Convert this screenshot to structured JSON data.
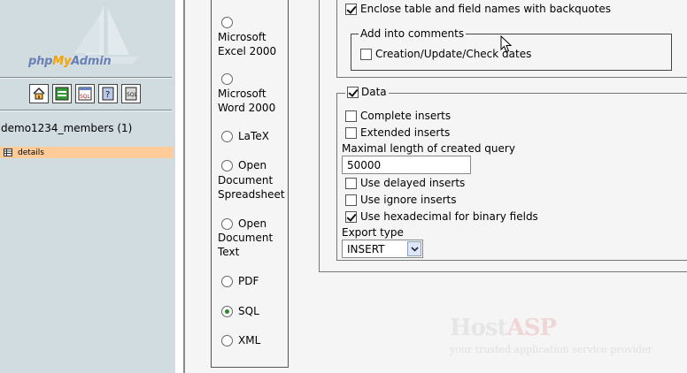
{
  "nav": {
    "logo": {
      "part1": "php",
      "part2": "My",
      "part3": "Admin"
    },
    "toolbar": [
      {
        "icon": "home-icon"
      },
      {
        "icon": "query-window-icon"
      },
      {
        "icon": "sql-icon"
      },
      {
        "icon": "help-icon"
      },
      {
        "icon": "documentation-icon"
      }
    ],
    "database": "demo1234_members (1)",
    "tables": [
      {
        "name": "details"
      }
    ]
  },
  "export": {
    "formats": [
      {
        "label1": "Microsoft",
        "label2": "Excel 2000",
        "selected": false
      },
      {
        "label1": "Microsoft",
        "label2": "Word 2000",
        "selected": false
      },
      {
        "label1": "LaTeX",
        "selected": false
      },
      {
        "label1": "Open",
        "label2": "Document",
        "label3": "Spreadsheet",
        "selected": false
      },
      {
        "label1": "Open",
        "label2": "Document",
        "label3": "Text",
        "selected": false
      },
      {
        "label1": "PDF",
        "selected": false
      },
      {
        "label1": "SQL",
        "selected": true
      },
      {
        "label1": "XML",
        "selected": false
      }
    ],
    "structure": {
      "backquotes": {
        "label": "Enclose table and field names with backquotes",
        "checked": true
      },
      "comments_legend": "Add into comments",
      "creation_dates": {
        "label": "Creation/Update/Check dates",
        "checked": false
      }
    },
    "data": {
      "legend": "Data",
      "checked": true,
      "complete_inserts": {
        "label": "Complete inserts",
        "checked": false
      },
      "extended_inserts": {
        "label": "Extended inserts",
        "checked": false
      },
      "max_length_label": "Maximal length of created query",
      "max_length_value": "50000",
      "delayed_inserts": {
        "label": "Use delayed inserts",
        "checked": false
      },
      "ignore_inserts": {
        "label": "Use ignore inserts",
        "checked": false
      },
      "hex_binary": {
        "label": "Use hexadecimal for binary fields",
        "checked": true
      },
      "export_type_label": "Export type",
      "export_type_value": "INSERT"
    }
  },
  "watermark": {
    "brand1": "Host",
    "brand2": "ASP",
    "tagline": "your trusted application service provider"
  }
}
